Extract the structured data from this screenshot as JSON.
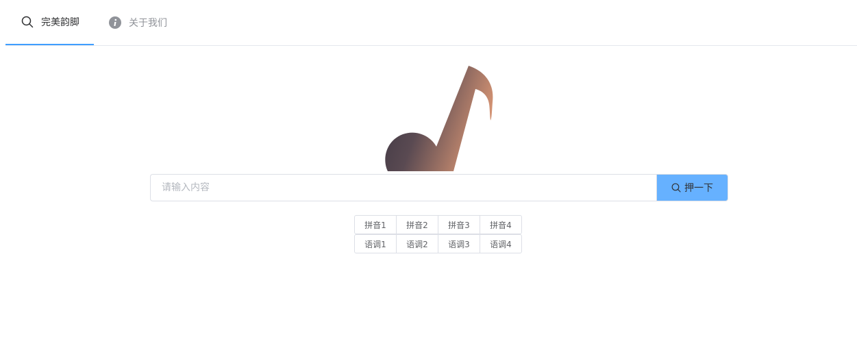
{
  "tabs": [
    {
      "label": "完美韵脚",
      "icon": "search-icon",
      "active": true
    },
    {
      "label": "关于我们",
      "icon": "info-icon",
      "active": false
    }
  ],
  "logo": {
    "icon": "music-note-icon"
  },
  "search": {
    "placeholder": "请输入内容",
    "value": "",
    "button_label": "押一下",
    "button_icon": "search-icon"
  },
  "pinyin_buttons": [
    "拼音1",
    "拼音2",
    "拼音3",
    "拼音4"
  ],
  "tone_buttons": [
    "语调1",
    "语调2",
    "语调3",
    "语调4"
  ],
  "colors": {
    "accent": "#409eff",
    "search_button_bg": "#66b1ff",
    "border": "#dcdfe6",
    "logo_gradient_start": "#3a3440",
    "logo_gradient_end": "#d19172"
  }
}
